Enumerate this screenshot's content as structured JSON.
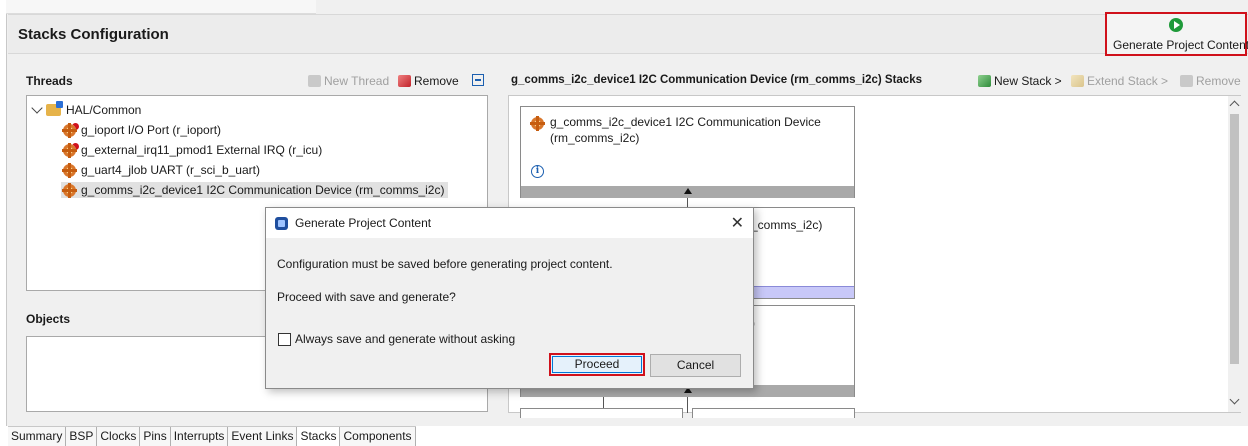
{
  "header": {
    "title": "Stacks Configuration",
    "generate_button_label": "Generate Project Content"
  },
  "threads_panel": {
    "title": "Threads",
    "new_thread_label": "New Thread",
    "remove_label": "Remove",
    "tree": {
      "root_label": "HAL/Common",
      "items": [
        {
          "label": "g_ioport I/O Port (r_ioport)"
        },
        {
          "label": "g_external_irq11_pmod1 External IRQ (r_icu)"
        },
        {
          "label": "g_uart4_jlob UART (r_sci_b_uart)"
        },
        {
          "label": "g_comms_i2c_device1 I2C Communication Device (rm_comms_i2c)"
        }
      ]
    }
  },
  "objects_panel": {
    "title": "Objects"
  },
  "stacks_panel": {
    "title": "g_comms_i2c_device1 I2C Communication Device (rm_comms_i2c) Stacks",
    "new_stack_label": "New Stack >",
    "extend_stack_label": "Extend Stack >",
    "remove_label": "Remove",
    "block1_line1": "g_comms_i2c_device1 I2C Communication Device",
    "block1_line2": "(rm_comms_i2c)",
    "info_glyph": "i",
    "block2_partial": "_comms_i2c)",
    "block3_partial": ")"
  },
  "bottom_tabs": [
    "Summary",
    "BSP",
    "Clocks",
    "Pins",
    "Interrupts",
    "Event Links",
    "Stacks",
    "Components"
  ],
  "dialog": {
    "title": "Generate Project Content",
    "close_glyph": "✕",
    "message1": "Configuration must be saved before generating project content.",
    "message2": "Proceed with save and generate?",
    "checkbox_label": "Always save and generate without asking",
    "checkbox_checked": false,
    "proceed_label": "Proceed",
    "cancel_label": "Cancel"
  },
  "colors": {
    "highlight_red": "#d0111b",
    "generate_icon_green": "#1f9a3a",
    "selection_grey": "#e1e1e1",
    "lavender_bar": "#c8c8f8"
  }
}
